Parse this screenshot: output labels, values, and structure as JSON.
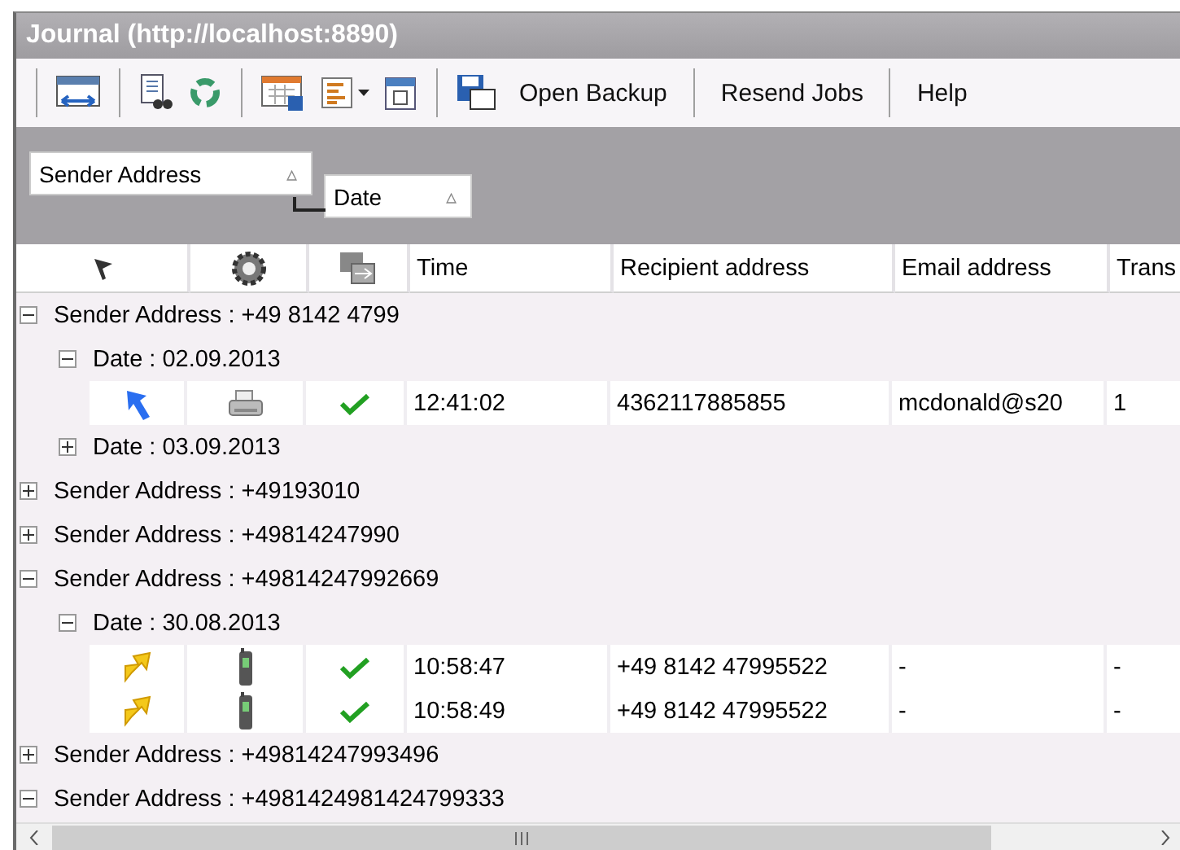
{
  "window": {
    "title": "Journal (http://localhost:8890)"
  },
  "toolbar": {
    "text_buttons": [
      "Open Backup",
      "Resend Jobs",
      "Help"
    ]
  },
  "group_panel": {
    "fields": [
      {
        "label": "Sender Address",
        "sort": "▵"
      },
      {
        "label": "Date",
        "sort": "▵"
      }
    ]
  },
  "table": {
    "columns": [
      {
        "kind": "flag-icon"
      },
      {
        "kind": "gear-icon"
      },
      {
        "kind": "transfer-icon"
      },
      {
        "kind": "text",
        "label": "Time"
      },
      {
        "kind": "text",
        "label": "Recipient address"
      },
      {
        "kind": "text",
        "label": "Email address"
      },
      {
        "kind": "text",
        "label": "Trans"
      }
    ],
    "groups": [
      {
        "label": "Sender Address : +49 8142 4799",
        "expanded": true,
        "children": [
          {
            "label": "Date : 02.09.2013",
            "expanded": true,
            "rows": [
              {
                "icons": [
                  {
                    "kind": "incoming"
                  },
                  {
                    "kind": "fax"
                  },
                  {
                    "kind": "ok"
                  }
                ],
                "cells": [
                  "12:41:02",
                  "4362117885855",
                  "mcdonald@s20",
                  "1"
                ]
              }
            ]
          },
          {
            "label": "Date : 03.09.2013",
            "expanded": false
          }
        ]
      },
      {
        "label": "Sender Address : +49193010",
        "expanded": false
      },
      {
        "label": "Sender Address : +49814247990",
        "expanded": false
      },
      {
        "label": "Sender Address : +49814247992669",
        "expanded": true,
        "children": [
          {
            "label": "Date : 30.08.2013",
            "expanded": true,
            "rows": [
              {
                "icons": [
                  {
                    "kind": "outgoing"
                  },
                  {
                    "kind": "mobile"
                  },
                  {
                    "kind": "ok"
                  }
                ],
                "cells": [
                  "10:58:47",
                  "+49 8142 47995522",
                  "-",
                  "-"
                ]
              },
              {
                "icons": [
                  {
                    "kind": "outgoing"
                  },
                  {
                    "kind": "mobile"
                  },
                  {
                    "kind": "ok"
                  }
                ],
                "cells": [
                  "10:58:49",
                  "+49 8142 47995522",
                  "-",
                  "-"
                ]
              }
            ]
          }
        ]
      },
      {
        "label": "Sender Address : +49814247993496",
        "expanded": false
      },
      {
        "label": "Sender Address : +4981424981424799333",
        "expanded": true
      }
    ]
  }
}
